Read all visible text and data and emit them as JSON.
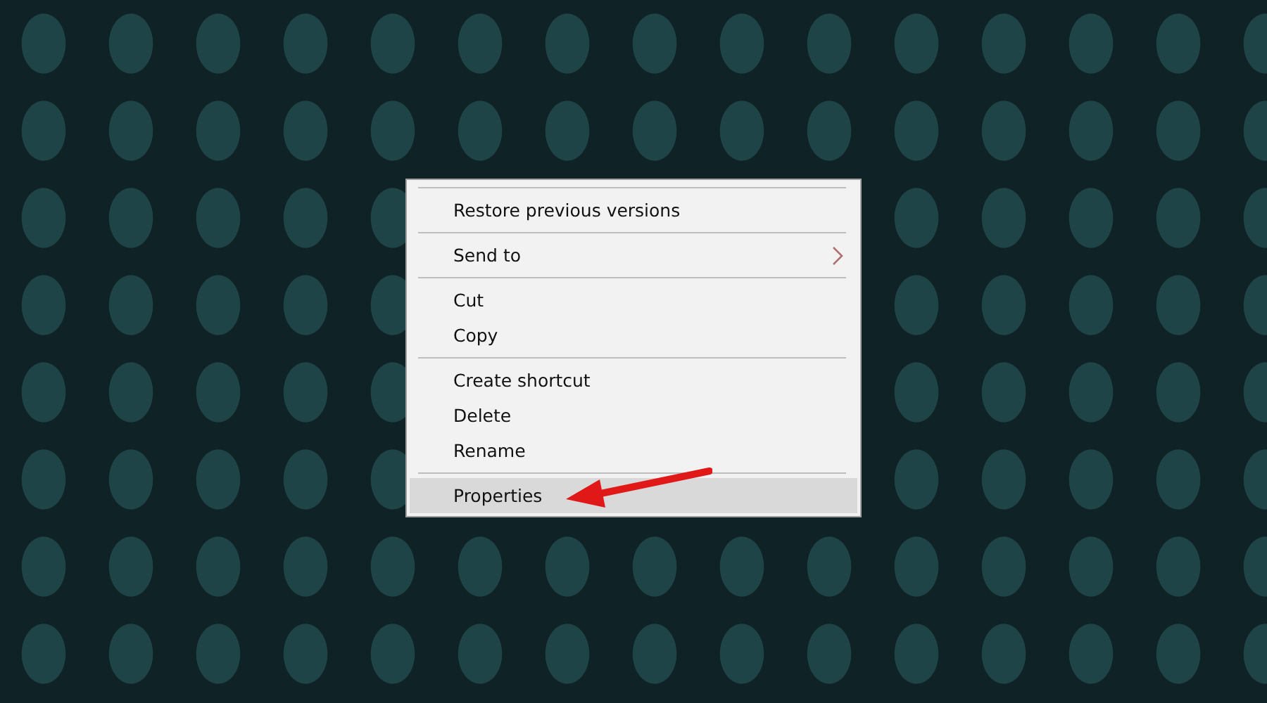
{
  "context_menu": {
    "groups": [
      {
        "items": [
          {
            "label": "Restore previous versions",
            "selected": false,
            "has_submenu": false
          }
        ]
      },
      {
        "items": [
          {
            "label": "Send to",
            "selected": false,
            "has_submenu": true
          }
        ]
      },
      {
        "items": [
          {
            "label": "Cut",
            "selected": false,
            "has_submenu": false
          },
          {
            "label": "Copy",
            "selected": false,
            "has_submenu": false
          }
        ]
      },
      {
        "items": [
          {
            "label": "Create shortcut",
            "selected": false,
            "has_submenu": false
          },
          {
            "label": "Delete",
            "selected": false,
            "has_submenu": false
          },
          {
            "label": "Rename",
            "selected": false,
            "has_submenu": false
          }
        ]
      },
      {
        "items": [
          {
            "label": "Properties",
            "selected": true,
            "has_submenu": false
          }
        ]
      }
    ]
  }
}
